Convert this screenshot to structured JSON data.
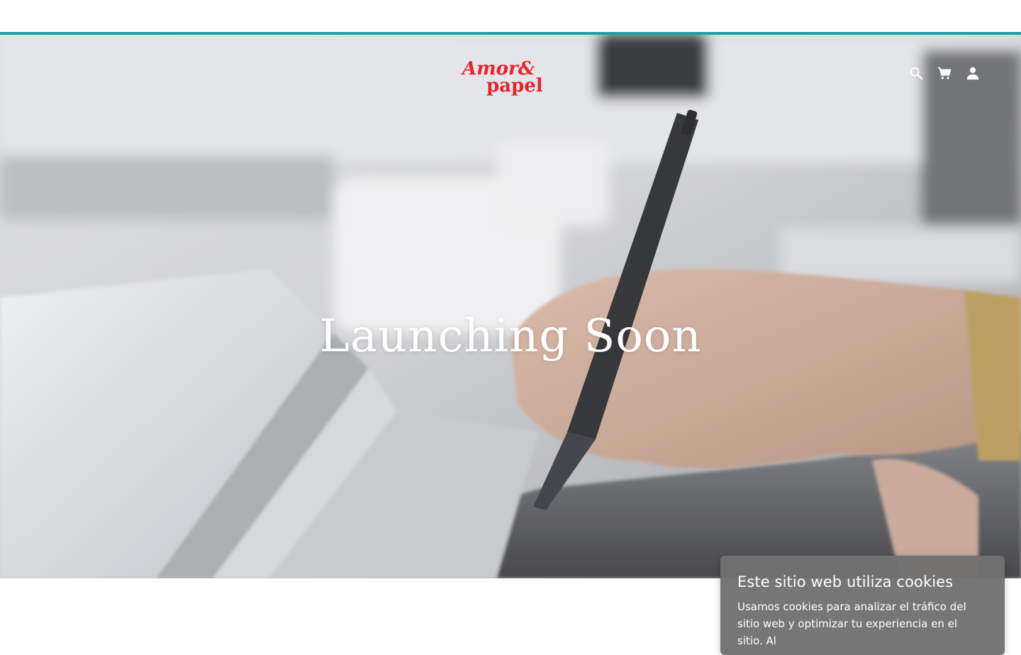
{
  "header": {
    "logo_line1": "Amor&",
    "logo_line2": "papel",
    "icons": [
      "search-icon",
      "cart-icon",
      "user-icon"
    ]
  },
  "hero": {
    "title": "Launching Soon"
  },
  "cookie_banner": {
    "title": "Este sitio web utiliza cookies",
    "text": "Usamos cookies para analizar el tráfico del sitio web y optimizar tu experiencia en el sitio. Al"
  },
  "colors": {
    "accent": "#1aa3a6",
    "logo_red": "#e8232a",
    "icon_white": "#ffffff",
    "cookie_bg": "#707070"
  }
}
